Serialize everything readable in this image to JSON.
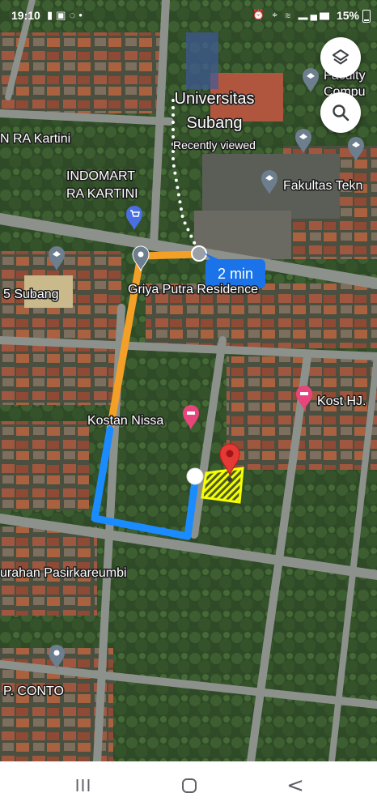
{
  "status_bar": {
    "time": "19:10",
    "left_icons": [
      "sim-alert-icon",
      "gallery-icon",
      "whatsapp-icon"
    ],
    "right_icons": [
      "alarm-icon",
      "location-icon",
      "wifi-icon",
      "signal-icon"
    ],
    "volte1": "Vo)) LTE1",
    "volte2": "Vo)) LTE2",
    "battery": "15%"
  },
  "map": {
    "places": {
      "universitas_subang_line1": "Universitas",
      "universitas_subang_line2": "Subang",
      "recently_viewed": "Recently viewed",
      "faculty_partial_1": "Faculty",
      "faculty_partial_2": "Compu",
      "fakultas_tekn": "Fakultas Tekn",
      "ra_kartini": "N RA Kartini",
      "indomart_line1": "INDOMART",
      "indomart_line2": "RA KARTINI",
      "five_subang": "5 Subang",
      "griya_putra": "Griya Putra Residence",
      "kostan_nissa": "Kostan Nissa",
      "kost_hj": "Kost HJ.",
      "kelurahan": "urahan Pasirkareumbi",
      "p_conto": "P. CONTO"
    },
    "route": {
      "duration": "2 min",
      "colors": {
        "walking_dots": "#ffffff",
        "orange": "#f4a026",
        "blue": "#1a8cff"
      }
    },
    "destination_pin_color": "#e53935",
    "selected_area_color": "#f6ff00"
  },
  "controls": {
    "layers_button": "layers-icon",
    "search_button": "search-icon"
  },
  "nav_bar": {
    "recents": "III",
    "back": "<"
  }
}
